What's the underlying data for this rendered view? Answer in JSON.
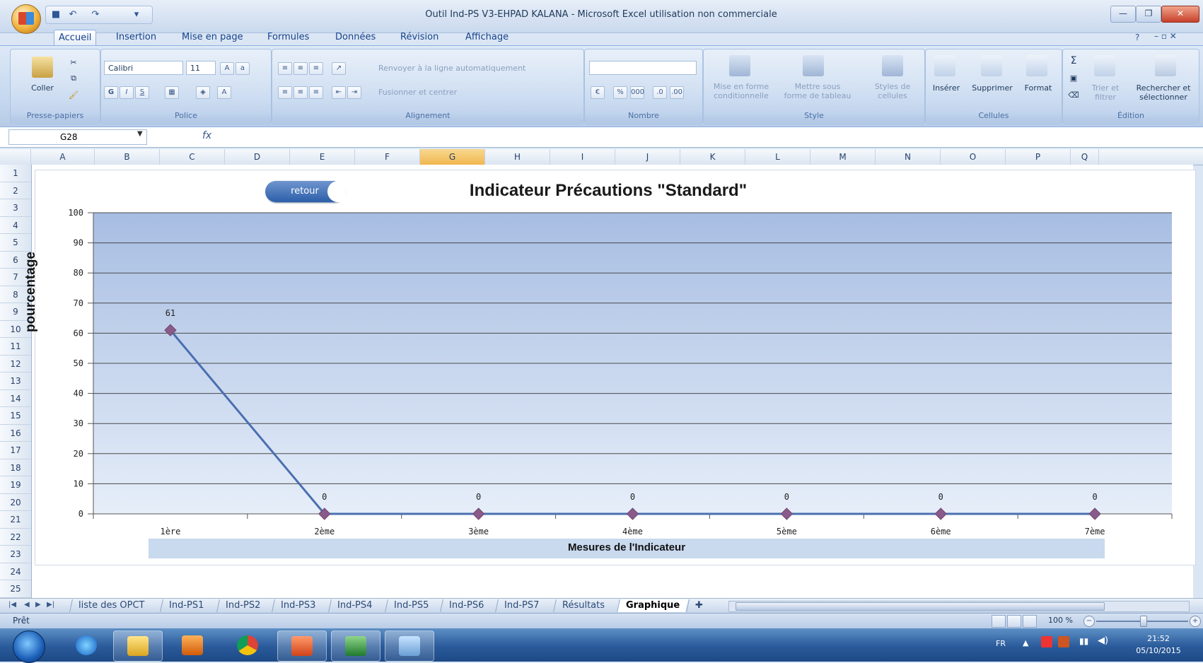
{
  "window": {
    "title": "Outil Ind-PS V3-EHPAD KALANA - Microsoft Excel utilisation non commerciale"
  },
  "ribbon": {
    "tabs": [
      "Accueil",
      "Insertion",
      "Mise en page",
      "Formules",
      "Données",
      "Révision",
      "Affichage"
    ],
    "groups": {
      "clipboard": {
        "label": "Presse-papiers",
        "paste": "Coller"
      },
      "font": {
        "label": "Police",
        "font_name": "Calibri",
        "font_size": "11"
      },
      "alignment": {
        "label": "Alignement",
        "wrap": "Renvoyer à la ligne automatiquement",
        "merge": "Fusionner et centrer"
      },
      "number": {
        "label": "Nombre"
      },
      "style": {
        "label": "Style",
        "conditional": "Mise en forme conditionnelle",
        "table": "Mettre sous forme de tableau",
        "cell_styles": "Styles de cellules"
      },
      "cells": {
        "label": "Cellules",
        "insert": "Insérer",
        "delete": "Supprimer",
        "format": "Format"
      },
      "editing": {
        "label": "Édition",
        "sort": "Trier et filtrer",
        "find": "Rechercher et sélectionner"
      }
    }
  },
  "formula_bar": {
    "name_box": "G28",
    "fx": "fx"
  },
  "columns": [
    "A",
    "B",
    "C",
    "D",
    "E",
    "F",
    "G",
    "H",
    "I",
    "J",
    "K",
    "L",
    "M",
    "N",
    "O",
    "P",
    "Q"
  ],
  "selected_column": "G",
  "rows": [
    "1",
    "2",
    "3",
    "4",
    "5",
    "6",
    "7",
    "8",
    "9",
    "10",
    "11",
    "12",
    "13",
    "14",
    "15",
    "16",
    "17",
    "18",
    "19",
    "20",
    "21",
    "22",
    "23",
    "24",
    "25"
  ],
  "retour_button": "retour",
  "chart_data": {
    "type": "line",
    "title": "Indicateur Précautions \"Standard\"",
    "xlabel": "Mesures de l'Indicateur",
    "ylabel": "pourcentage",
    "categories": [
      "1ère",
      "2ème",
      "3ème",
      "4ème",
      "5ème",
      "6ème",
      "7ème"
    ],
    "values": [
      61,
      0,
      0,
      0,
      0,
      0,
      0
    ],
    "data_labels": [
      "61",
      "0",
      "0",
      "0",
      "0",
      "0",
      "0"
    ],
    "ylim": [
      0,
      100
    ],
    "yticks": [
      0,
      10,
      20,
      30,
      40,
      50,
      60,
      70,
      80,
      90,
      100
    ],
    "grid": true,
    "colors": {
      "line": "#4a6fb0",
      "marker": "#8a5b8a"
    }
  },
  "sheet_tabs": [
    "liste des OPCT",
    "Ind-PS1",
    "Ind-PS2",
    "Ind-PS3",
    "Ind-PS4",
    "Ind-PS5",
    "Ind-PS6",
    "Ind-PS7",
    "Résultats",
    "Graphique"
  ],
  "active_sheet": "Graphique",
  "status": {
    "text": "Prêt",
    "zoom": "100 %"
  },
  "taskbar": {
    "lang": "FR",
    "time": "21:52",
    "date": "05/10/2015"
  }
}
